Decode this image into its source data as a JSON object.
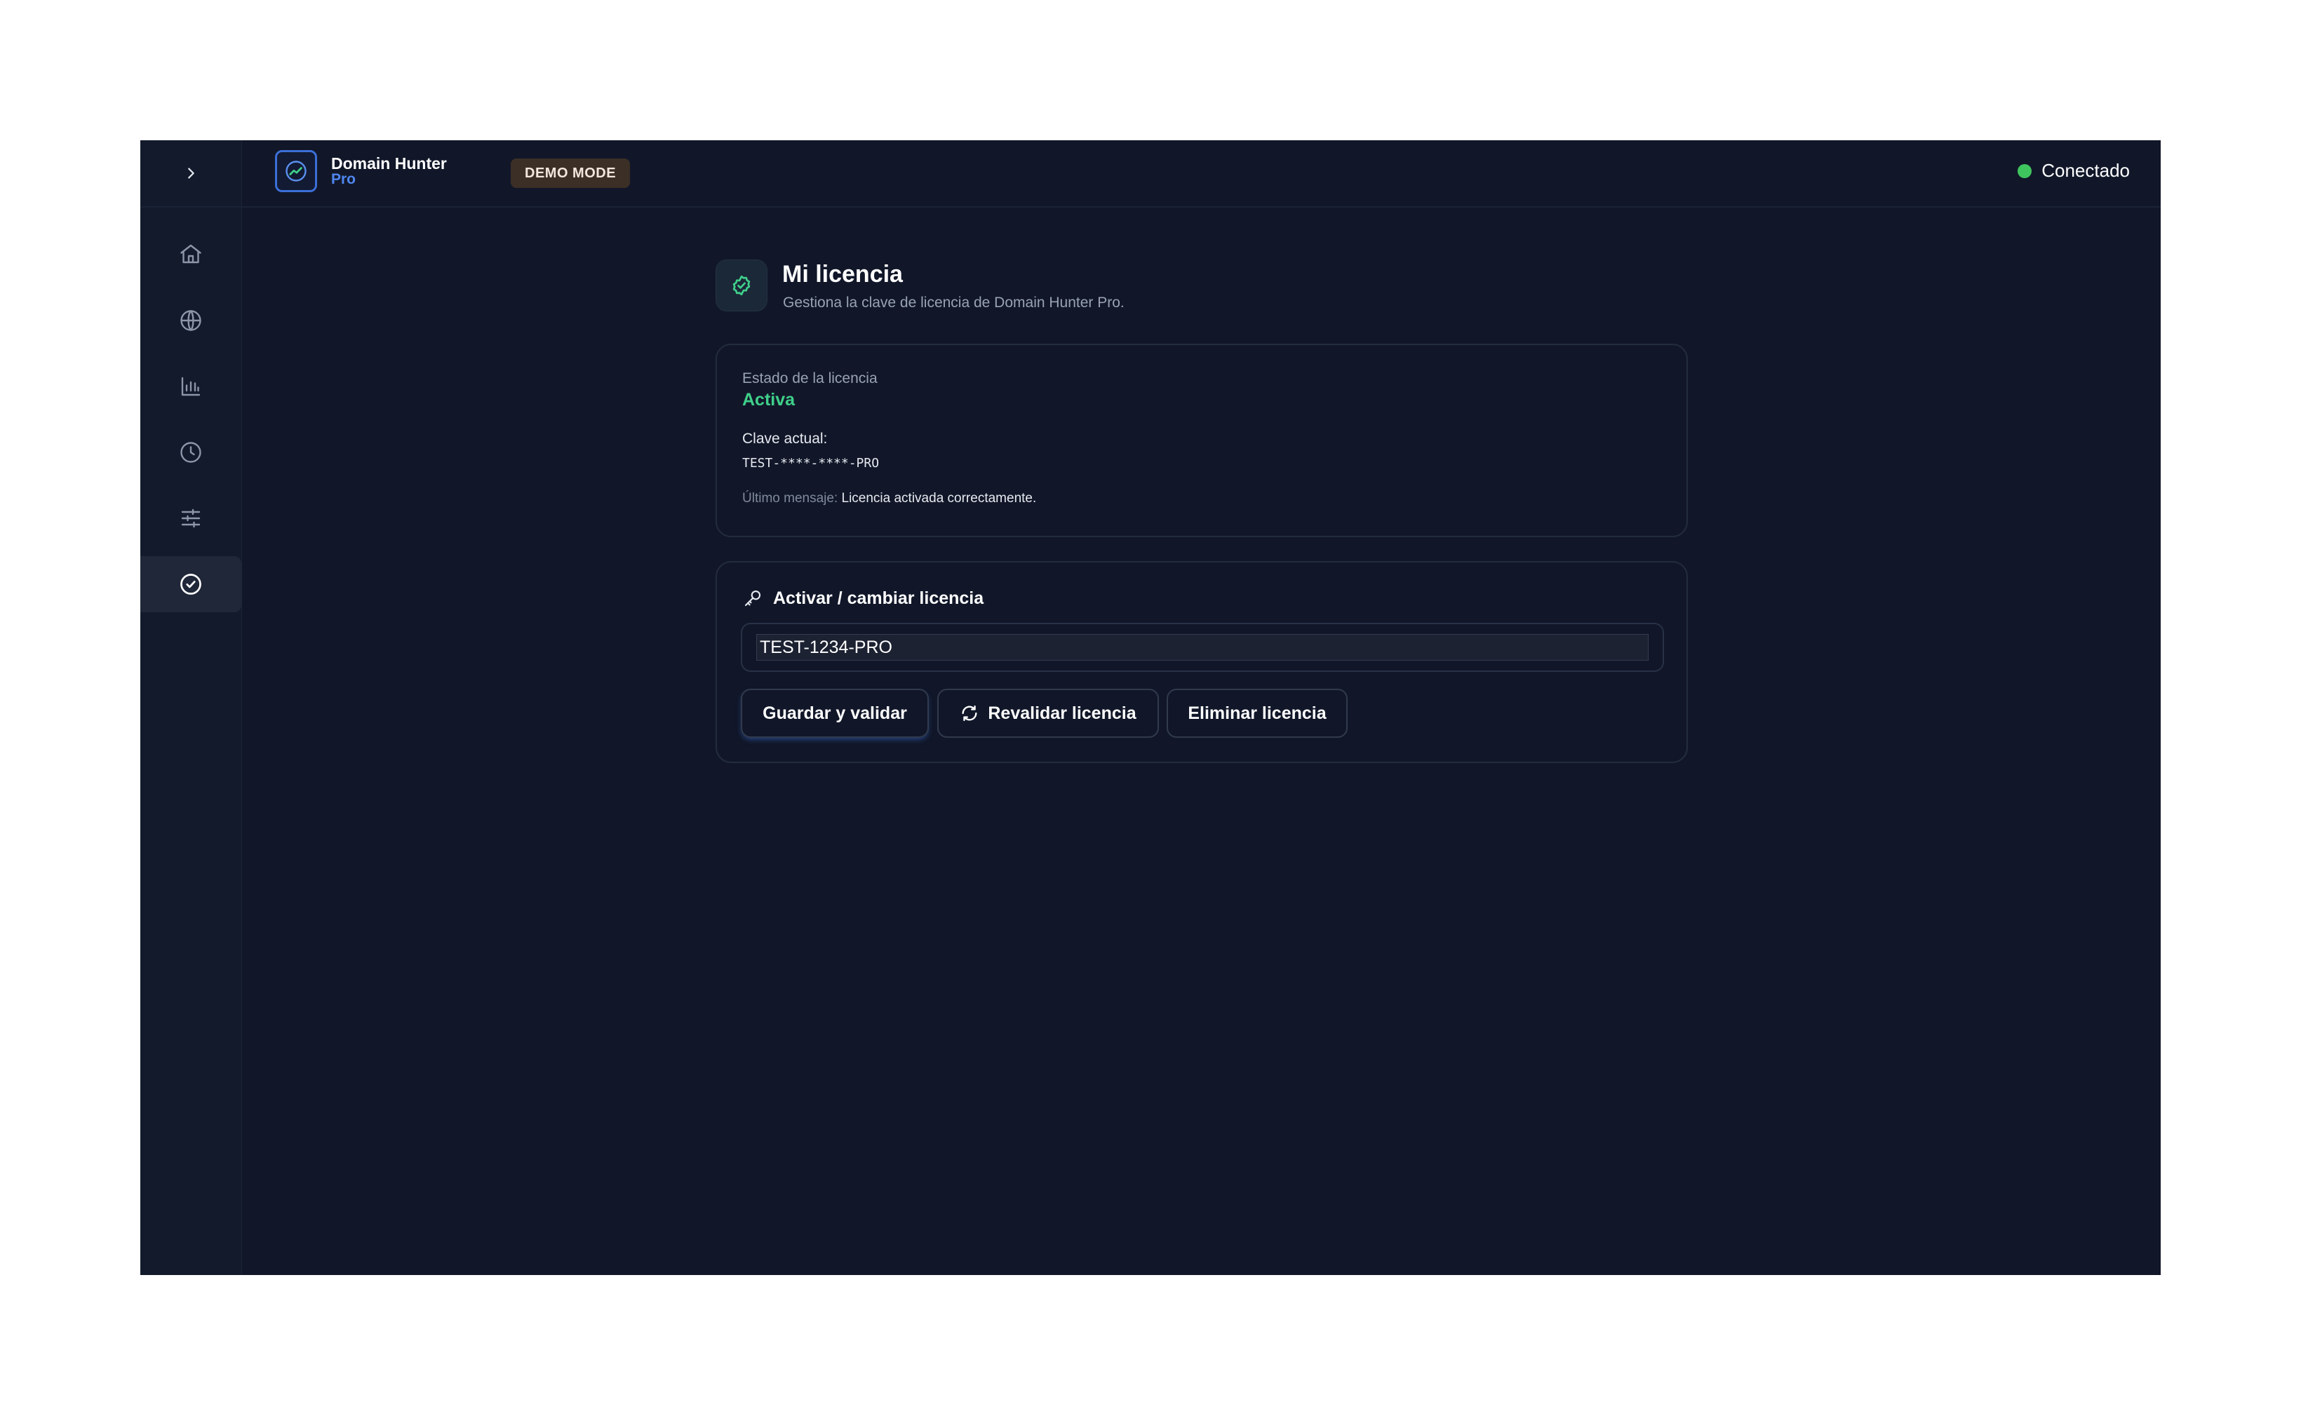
{
  "app": {
    "brand_name": "Domain Hunter",
    "brand_sub": "Pro",
    "demo_badge": "DEMO MODE",
    "connection_status": "Conectado",
    "colors": {
      "background": "#111729",
      "accent": "#3b6fd8",
      "success": "#3fd08a",
      "status_online": "#3fc55e",
      "demo_badge": "#3b2f26"
    }
  },
  "sidebar": {
    "toggle_icon": "chevron-right-icon",
    "items": [
      {
        "id": "home",
        "icon": "home-icon",
        "active": false
      },
      {
        "id": "domains",
        "icon": "globe-icon",
        "active": false
      },
      {
        "id": "stats",
        "icon": "bar-chart-icon",
        "active": false
      },
      {
        "id": "history",
        "icon": "clock-icon",
        "active": false
      },
      {
        "id": "settings",
        "icon": "sliders-icon",
        "active": false
      },
      {
        "id": "license",
        "icon": "badge-check-icon",
        "active": true
      }
    ]
  },
  "page": {
    "title": "Mi licencia",
    "subtitle": "Gestiona la clave de licencia de Domain Hunter Pro."
  },
  "status_card": {
    "status_label": "Estado de la licencia",
    "status_value": "Activa",
    "key_label": "Clave actual:",
    "key_value": "TEST-****-****-PRO",
    "message_label": "Último mensaje:",
    "message_value": "Licencia activada correctamente."
  },
  "activate_card": {
    "title": "Activar / cambiar licencia",
    "input_value": "TEST-1234-PRO",
    "save_button": "Guardar y validar",
    "revalidate_button": "Revalidar licencia",
    "delete_button": "Eliminar licencia"
  }
}
